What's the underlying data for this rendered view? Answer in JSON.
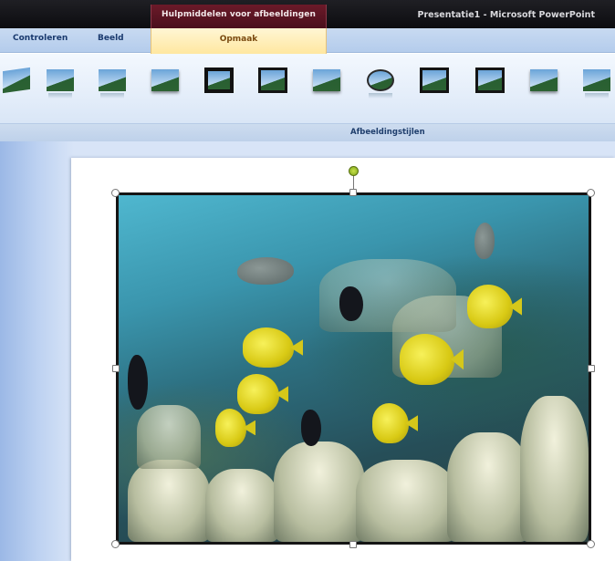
{
  "window": {
    "title": "Presentatie1 - Microsoft PowerPoint",
    "contextual_tab_header": "Hulpmiddelen voor afbeeldingen"
  },
  "ribbon": {
    "tabs": [
      {
        "label": "Controleren"
      },
      {
        "label": "Beeld"
      }
    ],
    "active_tab": "Opmaak",
    "group_label": "Afbeeldingstijlen",
    "picture_styles": [
      "style-tilted",
      "style-reflected",
      "style-reflected-rounded",
      "style-soft-edge",
      "style-thick-black-frame",
      "style-black-shadow-frame",
      "style-simple-frame",
      "style-oval",
      "style-metal-frame",
      "style-rounded-frame",
      "style-soft-frame",
      "style-rotated"
    ]
  },
  "colors": {
    "title_bar": "#111116",
    "contextual_tab": "#5a1424",
    "active_tab": "#ffe7a0",
    "ribbon": "#e2ecf9",
    "workspace": "#cfdef5"
  }
}
